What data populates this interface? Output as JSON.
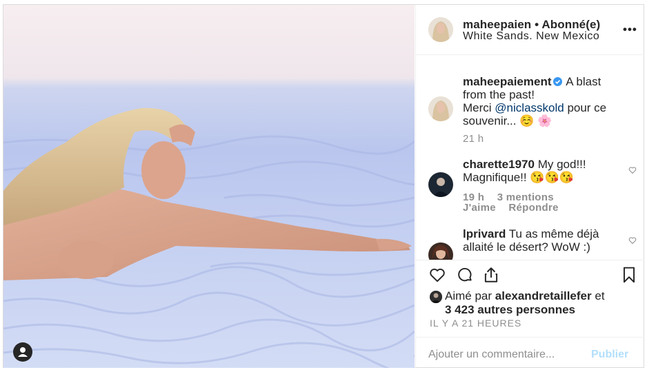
{
  "header": {
    "username": "maheepaien",
    "separator": "•",
    "follow_status": "Abonné(e)",
    "location": "White Sands. New Mexico",
    "more_icon": "more-horizontal-icon",
    "more_label": "•••"
  },
  "caption": {
    "username": "maheepaiement",
    "text_before": "A blast from the past!",
    "merci": "Merci",
    "mention": "@niclasskold",
    "text_after": "pour ce souvenir...",
    "emojis": "☺️ 🌸",
    "time": "21 h"
  },
  "comments": [
    {
      "username": "charette1970",
      "text": "My god!!! Magnifique!! 😘😘😘",
      "time": "19 h",
      "mentions": "3 mentions",
      "like_label": "J'aime",
      "reply_label": "Répondre"
    },
    {
      "username": "lprivard",
      "text": "Tu as même déjà allaité le désert? WoW :)"
    }
  ],
  "actions": {
    "like_icon": "heart-icon",
    "comment_icon": "comment-icon",
    "share_icon": "share-icon",
    "save_icon": "bookmark-icon"
  },
  "likes": {
    "prefix": "Aimé par",
    "user": "alexandretaillefer",
    "connector": "et",
    "others": "3 423 autres personnes"
  },
  "timestamp": "IL Y A 21 HEURES",
  "comment_box": {
    "placeholder": "Ajouter un commentaire...",
    "publish_label": "Publier"
  },
  "colors": {
    "link": "#00376b",
    "muted": "#8e8e8e",
    "publish_disabled": "#b2dffc",
    "verified": "#3897f0"
  }
}
